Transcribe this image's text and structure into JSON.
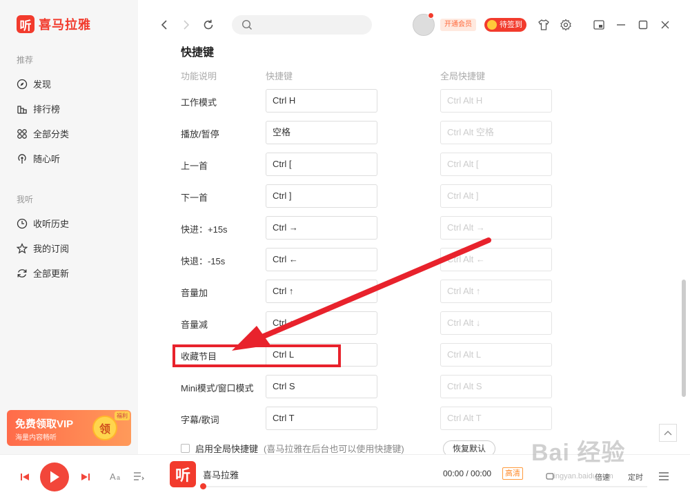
{
  "app": {
    "logo_badge": "听",
    "logo_text": "喜马拉雅"
  },
  "sidebar": {
    "section_recommend": "推荐",
    "recommend_items": [
      {
        "label": "发现",
        "icon": "compass-icon"
      },
      {
        "label": "排行榜",
        "icon": "chart-icon"
      },
      {
        "label": "全部分类",
        "icon": "category-icon"
      },
      {
        "label": "随心听",
        "icon": "broadcast-icon"
      }
    ],
    "section_mine": "我听",
    "mine_items": [
      {
        "label": "收听历史",
        "icon": "clock-icon"
      },
      {
        "label": "我的订阅",
        "icon": "star-icon"
      },
      {
        "label": "全部更新",
        "icon": "refresh-icon"
      }
    ],
    "vip": {
      "title": "免费领取VIP",
      "subtitle": "海量内容畅听",
      "coin": "领",
      "tag": "福利"
    }
  },
  "topbar": {
    "open_vip": "开通会员",
    "signin": "待签到"
  },
  "shortcuts": {
    "title": "快捷键",
    "headers": {
      "function": "功能说明",
      "key": "快捷键",
      "global_key": "全局快捷键"
    },
    "rows": [
      {
        "label": "工作模式",
        "key": "Ctrl H",
        "global": "Ctrl Alt H"
      },
      {
        "label": "播放/暂停",
        "key": "空格",
        "global": "Ctrl Alt 空格"
      },
      {
        "label": "上一首",
        "key": "Ctrl [",
        "global": "Ctrl Alt ["
      },
      {
        "label": "下一首",
        "key": "Ctrl ]",
        "global": "Ctrl Alt ]"
      },
      {
        "label": "快进：+15s",
        "key": "Ctrl →",
        "global": "Ctrl Alt →"
      },
      {
        "label": "快退：-15s",
        "key": "Ctrl ←",
        "global": "Ctrl Alt ←"
      },
      {
        "label": "音量加",
        "key": "Ctrl ↑",
        "global": "Ctrl Alt ↑"
      },
      {
        "label": "音量减",
        "key": "Ctrl ↓",
        "global": "Ctrl Alt ↓"
      },
      {
        "label": "收藏节目",
        "key": "Ctrl L",
        "global": "Ctrl Alt L"
      },
      {
        "label": "Mini模式/窗口模式",
        "key": "Ctrl S",
        "global": "Ctrl Alt S"
      },
      {
        "label": "字幕/歌词",
        "key": "Ctrl T",
        "global": "Ctrl Alt T"
      }
    ],
    "global_enable": "启用全局快捷键",
    "global_note": "(喜马拉雅在后台也可以使用快捷键)",
    "restore": "恢复默认"
  },
  "player": {
    "cover_glyph": "听",
    "track_title": "喜马拉雅",
    "time": "00:00 / 00:00",
    "quality": "高清",
    "speed_label": "倍速",
    "timer_label": "定时",
    "progress": 0
  },
  "watermark": {
    "text": "Bai  经验",
    "sub": "jingyan.baidu.com"
  },
  "colors": {
    "accent": "#f23b2d",
    "annotation": "#e8222c"
  }
}
